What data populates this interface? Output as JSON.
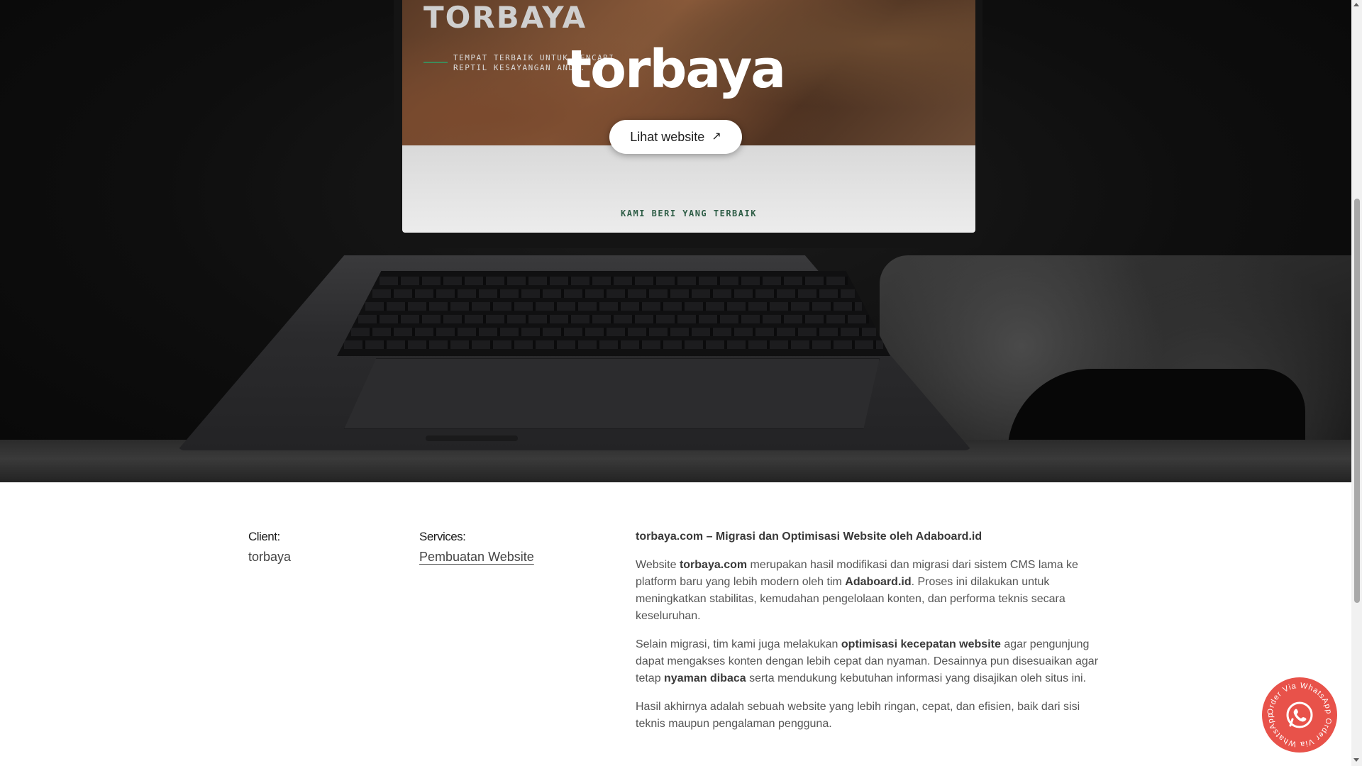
{
  "hero": {
    "title": "torbaya",
    "button_label": "Lihat website",
    "button_icon": "arrow-up-right-icon",
    "screen": {
      "brand": "TORBAYA",
      "tagline": "TEMPAT TERBAIK UNTUK MENCARI REPTIL KESAYANGAN ANDA.",
      "footer_text": "KAMI BERI YANG TERBAIK"
    }
  },
  "meta": {
    "client_label": "Client:",
    "client_value": "torbaya",
    "services_label": "Services:",
    "services_value": "Pembuatan Website"
  },
  "article": {
    "heading": "torbaya.com – Migrasi dan Optimisasi Website oleh Adaboard.id",
    "p1": {
      "t1": "Website ",
      "b1": "torbaya.com",
      "t2": " merupakan hasil modifikasi dan migrasi dari sistem CMS lama ke platform baru yang lebih modern oleh tim ",
      "b2": "Adaboard.id",
      "t3": ". Proses ini dilakukan untuk meningkatkan stabilitas, kemudahan pengelolaan konten, dan performa teknis secara keseluruhan."
    },
    "p2": {
      "t1": "Selain migrasi, tim kami juga melakukan ",
      "b1": "optimisasi kecepatan website",
      "t2": " agar pengunjung dapat mengakses konten dengan lebih cepat dan nyaman. Desainnya pun disesuaikan agar tetap ",
      "b2": "nyaman dibaca",
      "t3": " serta mendukung kebutuhan informasi yang disajikan oleh situs ini."
    },
    "p3": "Hasil akhirnya adalah sebuah website yang lebih ringan, cepat, dan efisien, baik dari sisi teknis maupun pengalaman pengguna."
  },
  "whatsapp": {
    "ring_text": "Order Via WhatsApp Order Via WhatsApp",
    "icon": "whatsapp-icon",
    "color": "#e8524a"
  }
}
